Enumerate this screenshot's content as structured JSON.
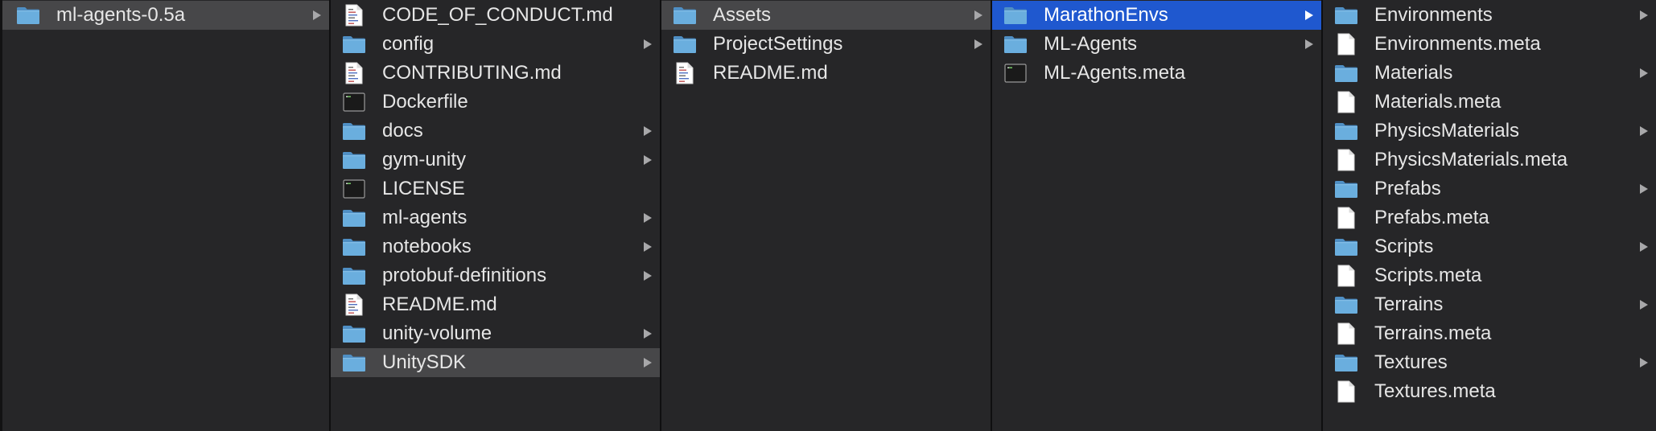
{
  "theme": {
    "background": "#262628",
    "selection_active": "#1f58cf",
    "selection_inactive": "#474749",
    "folder_blue": "#6aa8d8",
    "text": "#e6e6e6"
  },
  "columns": [
    {
      "items": [
        {
          "label": "ml-agents-0.5a",
          "icon": "folder-icon",
          "chevron": true,
          "selection": "inactive"
        }
      ]
    },
    {
      "items": [
        {
          "label": "CODE_OF_CONDUCT.md",
          "icon": "markdown-file-icon",
          "chevron": false
        },
        {
          "label": "config",
          "icon": "folder-icon",
          "chevron": true
        },
        {
          "label": "CONTRIBUTING.md",
          "icon": "markdown-file-icon",
          "chevron": false
        },
        {
          "label": "Dockerfile",
          "icon": "exec-file-icon",
          "chevron": false
        },
        {
          "label": "docs",
          "icon": "folder-icon",
          "chevron": true
        },
        {
          "label": "gym-unity",
          "icon": "folder-icon",
          "chevron": true
        },
        {
          "label": "LICENSE",
          "icon": "exec-file-icon",
          "chevron": false
        },
        {
          "label": "ml-agents",
          "icon": "folder-icon",
          "chevron": true
        },
        {
          "label": "notebooks",
          "icon": "folder-icon",
          "chevron": true
        },
        {
          "label": "protobuf-definitions",
          "icon": "folder-icon",
          "chevron": true
        },
        {
          "label": "README.md",
          "icon": "markdown-file-icon",
          "chevron": false
        },
        {
          "label": "unity-volume",
          "icon": "folder-icon",
          "chevron": true
        },
        {
          "label": "UnitySDK",
          "icon": "folder-icon",
          "chevron": true,
          "selection": "inactive"
        }
      ]
    },
    {
      "items": [
        {
          "label": "Assets",
          "icon": "folder-icon",
          "chevron": true,
          "selection": "inactive"
        },
        {
          "label": "ProjectSettings",
          "icon": "folder-icon",
          "chevron": true
        },
        {
          "label": "README.md",
          "icon": "markdown-file-icon",
          "chevron": false
        }
      ]
    },
    {
      "items": [
        {
          "label": "MarathonEnvs",
          "icon": "folder-icon",
          "chevron": true,
          "selection": "active"
        },
        {
          "label": "ML-Agents",
          "icon": "folder-icon",
          "chevron": true
        },
        {
          "label": "ML-Agents.meta",
          "icon": "exec-file-icon",
          "chevron": false
        }
      ]
    },
    {
      "items": [
        {
          "label": "Environments",
          "icon": "folder-icon",
          "chevron": true
        },
        {
          "label": "Environments.meta",
          "icon": "blank-file-icon",
          "chevron": false
        },
        {
          "label": "Materials",
          "icon": "folder-icon",
          "chevron": true
        },
        {
          "label": "Materials.meta",
          "icon": "blank-file-icon",
          "chevron": false
        },
        {
          "label": "PhysicsMaterials",
          "icon": "folder-icon",
          "chevron": true
        },
        {
          "label": "PhysicsMaterials.meta",
          "icon": "blank-file-icon",
          "chevron": false
        },
        {
          "label": "Prefabs",
          "icon": "folder-icon",
          "chevron": true
        },
        {
          "label": "Prefabs.meta",
          "icon": "blank-file-icon",
          "chevron": false
        },
        {
          "label": "Scripts",
          "icon": "folder-icon",
          "chevron": true
        },
        {
          "label": "Scripts.meta",
          "icon": "blank-file-icon",
          "chevron": false
        },
        {
          "label": "Terrains",
          "icon": "folder-icon",
          "chevron": true
        },
        {
          "label": "Terrains.meta",
          "icon": "blank-file-icon",
          "chevron": false
        },
        {
          "label": "Textures",
          "icon": "folder-icon",
          "chevron": true
        },
        {
          "label": "Textures.meta",
          "icon": "blank-file-icon",
          "chevron": false
        }
      ]
    }
  ]
}
